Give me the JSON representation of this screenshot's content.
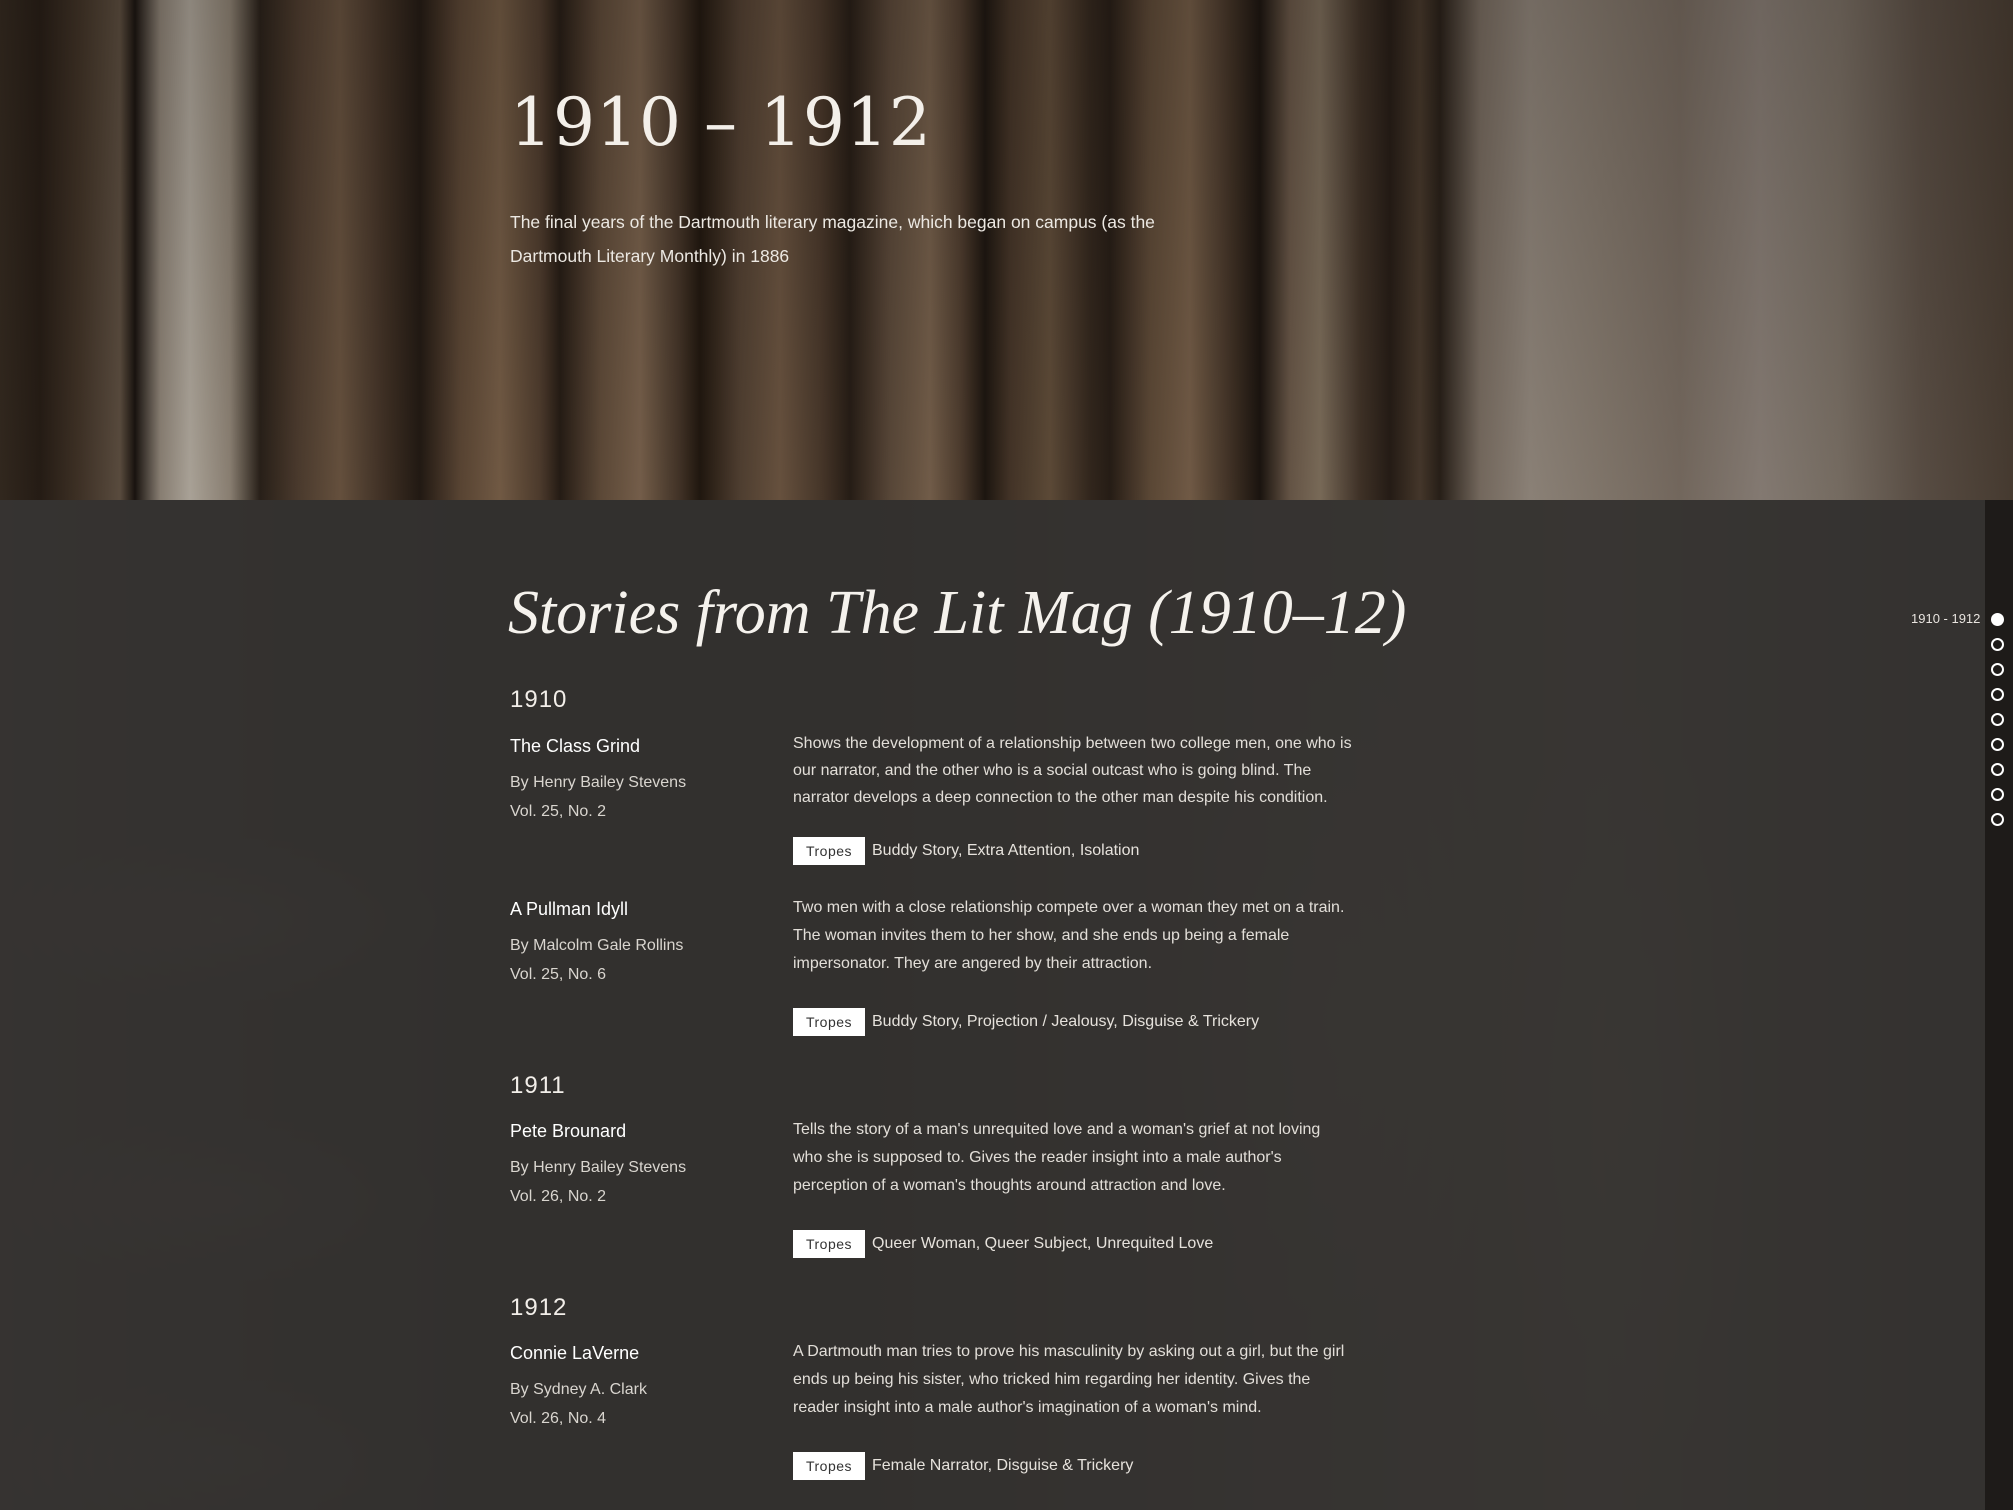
{
  "hero": {
    "title": "1910 – 1912",
    "subtitle_line1": "The final years of the Dartmouth literary magazine, which began on campus (as the",
    "subtitle_line2": "Dartmouth Literary Monthly) in 1886"
  },
  "section": {
    "title": "Stories from The Lit Mag (1910–12)"
  },
  "tropes_label": "Tropes",
  "years": [
    {
      "year": "1910",
      "stories": [
        {
          "title": "The Class Grind",
          "author": "By Henry Bailey Stevens",
          "volume": "Vol. 25, No. 2",
          "description": "Shows the development of a relationship between two college men, one who is our narrator, and the other who is a social outcast who is going blind. The narrator develops a deep connection to the other man despite his condition.",
          "tropes": "Buddy Story, Extra Attention, Isolation"
        },
        {
          "title": "A Pullman Idyll",
          "author": "By Malcolm Gale Rollins",
          "volume": "Vol. 25, No. 6",
          "description": "Two men with a close relationship compete over a woman they met on a train. The woman invites them to her show, and she ends up being a female impersonator. They are angered by their attraction.",
          "tropes": "Buddy Story, Projection / Jealousy, Disguise & Trickery"
        }
      ]
    },
    {
      "year": "1911",
      "stories": [
        {
          "title": "Pete Brounard",
          "author": "By Henry Bailey Stevens",
          "volume": "Vol. 26, No. 2",
          "description": "Tells the story of a man's unrequited love and a woman's grief at not loving who she is supposed to. Gives the reader insight into a male author's perception of a woman's thoughts around attraction and love.",
          "tropes": "Queer Woman, Queer Subject, Unrequited Love"
        }
      ]
    },
    {
      "year": "1912",
      "stories": [
        {
          "title": "Connie LaVerne",
          "author": "By Sydney A. Clark",
          "volume": "Vol. 26, No. 4",
          "description": "A Dartmouth man tries to prove his masculinity by asking out a girl, but the girl ends up being his sister, who tricked him regarding her identity. Gives the reader insight into a male author's imagination of a woman's mind.",
          "tropes": "Female Narrator, Disguise & Trickery"
        }
      ]
    }
  ],
  "side_nav": {
    "active_label": "1910 - 1912",
    "dot_count": 9,
    "active_index": 0
  }
}
